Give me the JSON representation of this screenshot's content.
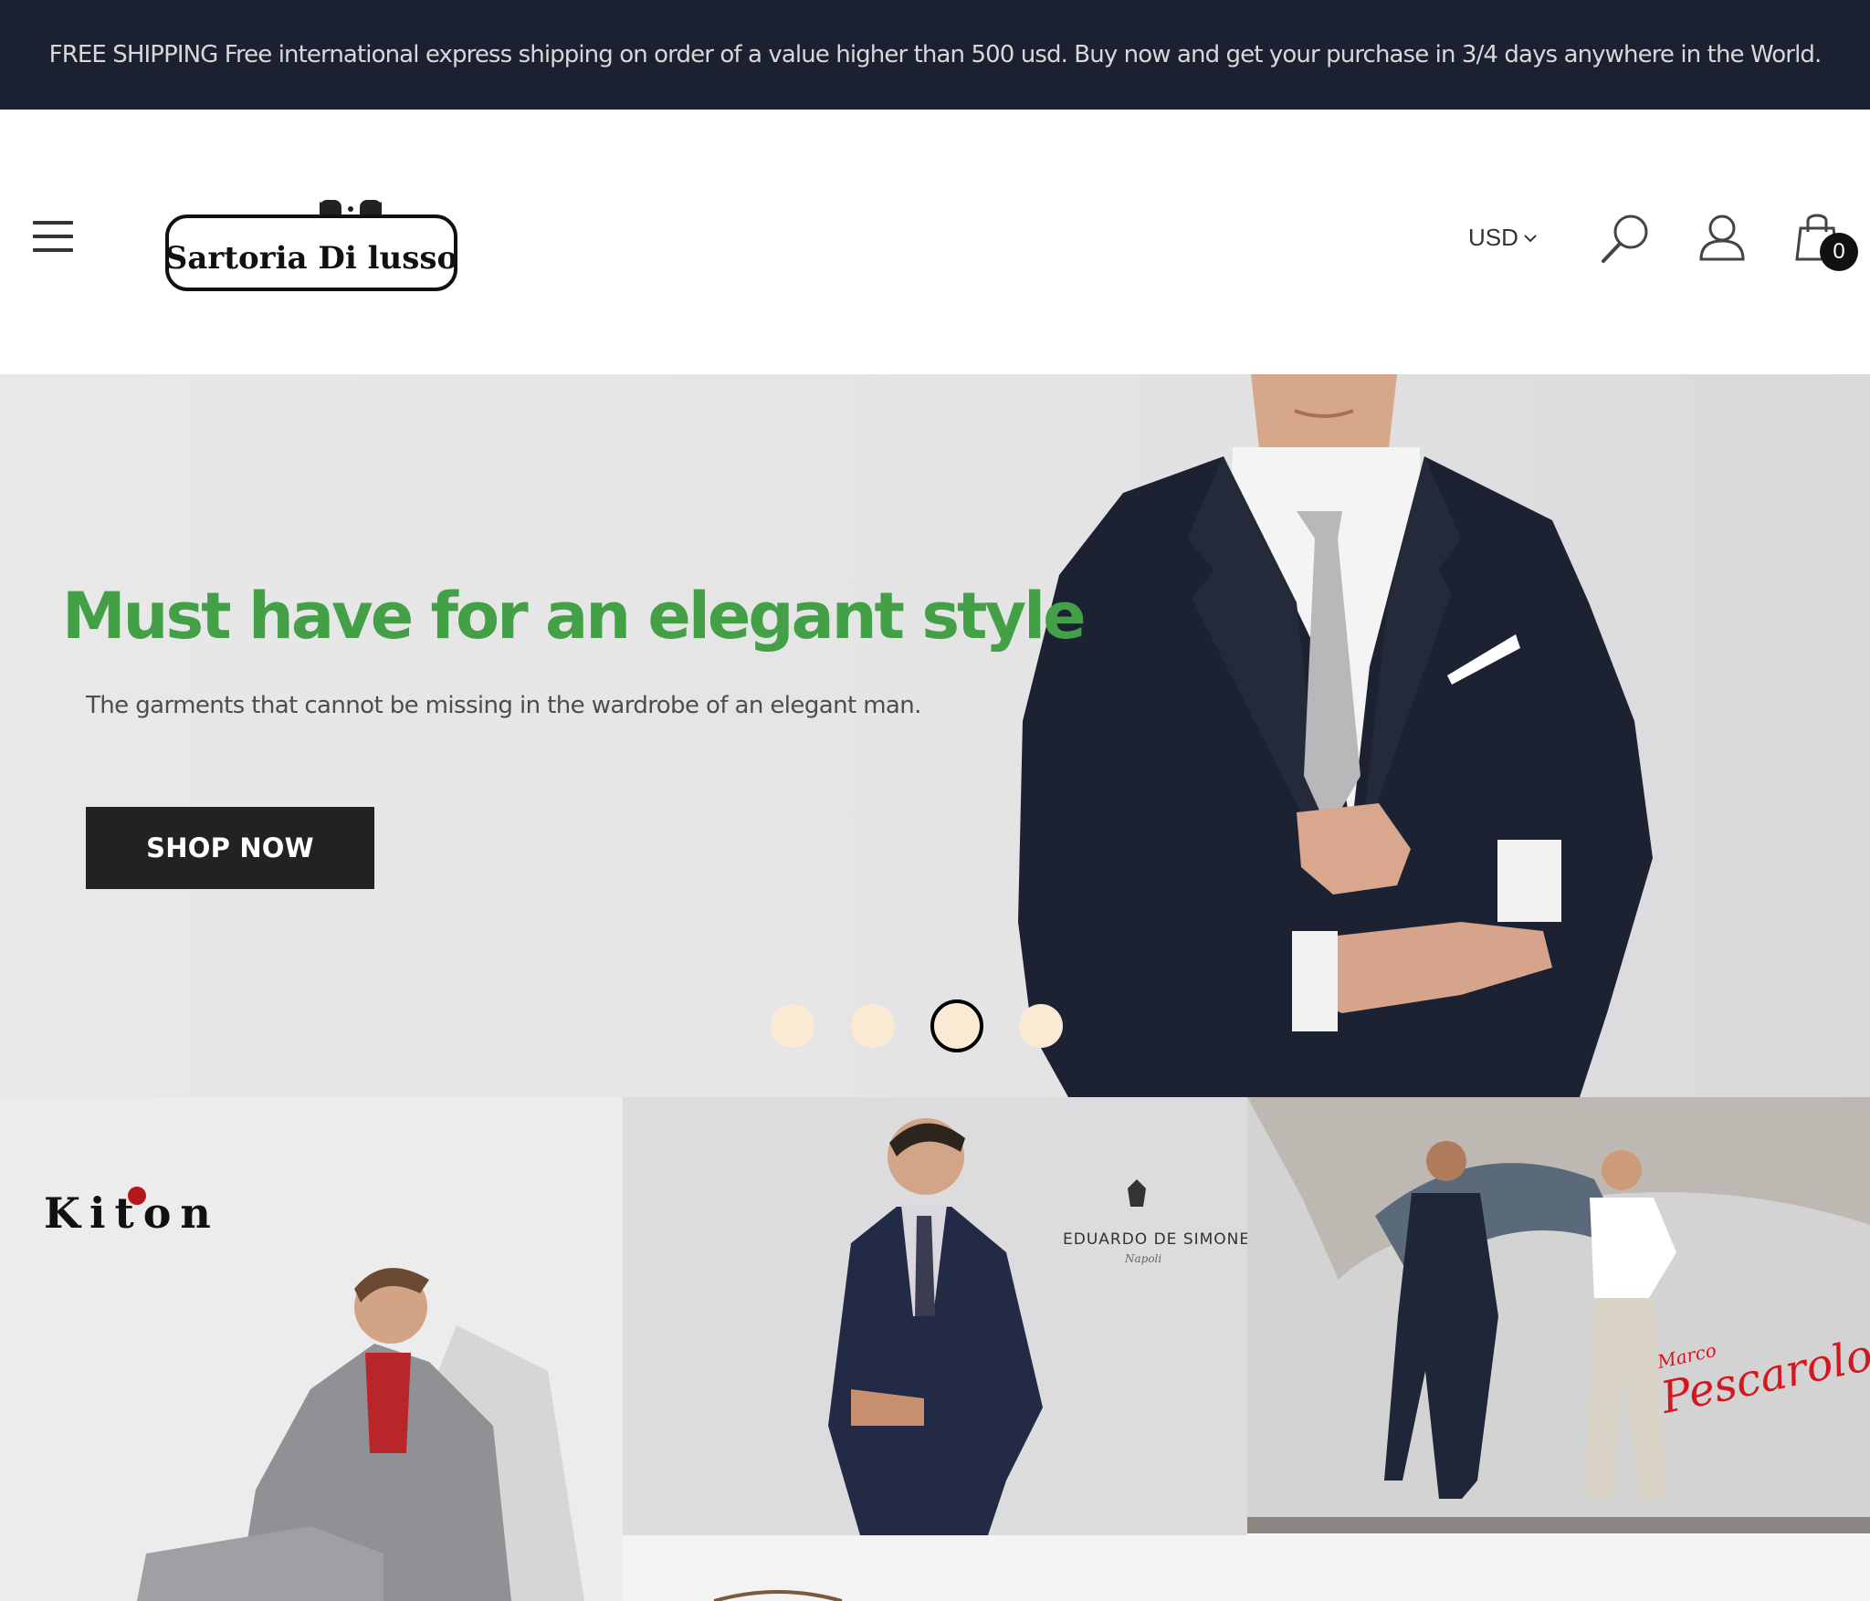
{
  "announcement": {
    "text": "FREE SHIPPING Free international express shipping on order of a value higher than 500 usd. Buy now and get your purchase in 3/4 days anywhere in the World."
  },
  "header": {
    "logo_text": "Sartoria Di lusso",
    "currency": "USD",
    "cart_count": "0"
  },
  "hero": {
    "title": "Must have for an elegant style",
    "subtitle": "The garments that cannot be missing in the wardrobe of an elegant man.",
    "cta_label": "SHOP NOW",
    "slides_total": 4,
    "active_slide": 3,
    "title_color": "#43a047"
  },
  "brands": {
    "kiton": "Kiton",
    "eduardo_de_simone": "EDUARDO DE SIMONE",
    "eduardo_de_simone_city": "Napoli",
    "marco_pescarolo_first": "Marco",
    "marco_pescarolo_last": "Pescarolo"
  },
  "colors": {
    "announcement_bg": "#1b2131",
    "button_bg": "#222222",
    "dot": "#fbead3",
    "accent_red": "#d6161f"
  }
}
